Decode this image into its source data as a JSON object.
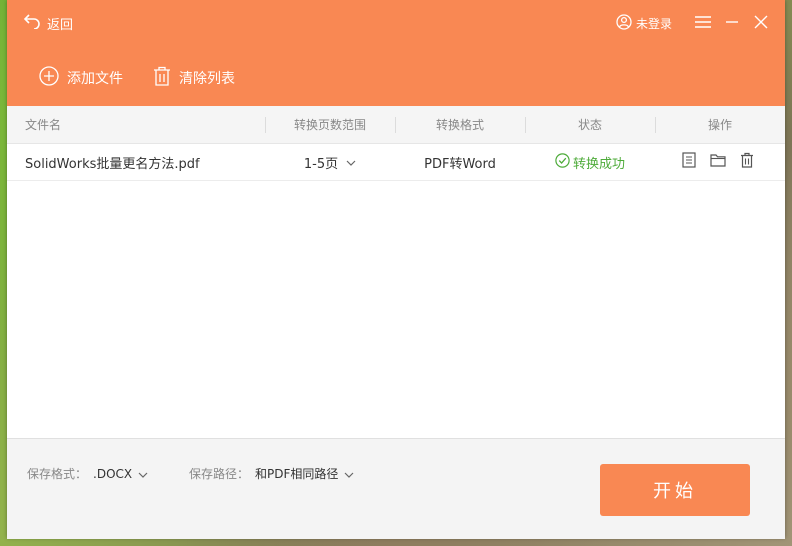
{
  "header": {
    "back_label": "返回",
    "login_label": "未登录"
  },
  "toolbar": {
    "add_label": "添加文件",
    "clear_label": "清除列表"
  },
  "table": {
    "columns": [
      "文件名",
      "转换页数范围",
      "转换格式",
      "状态",
      "操作"
    ],
    "rows": [
      {
        "filename": "SolidWorks批量更名方法.pdf",
        "page_range": "1-5页",
        "format": "PDF转Word",
        "status": "转换成功"
      }
    ]
  },
  "footer": {
    "save_format_label": "保存格式：",
    "save_format_value": ".DOCX",
    "save_path_label": "保存路径：",
    "save_path_value": "和PDF相同路径",
    "start_label": "开始"
  },
  "colors": {
    "accent": "#f98853",
    "success": "#4eab3a"
  }
}
